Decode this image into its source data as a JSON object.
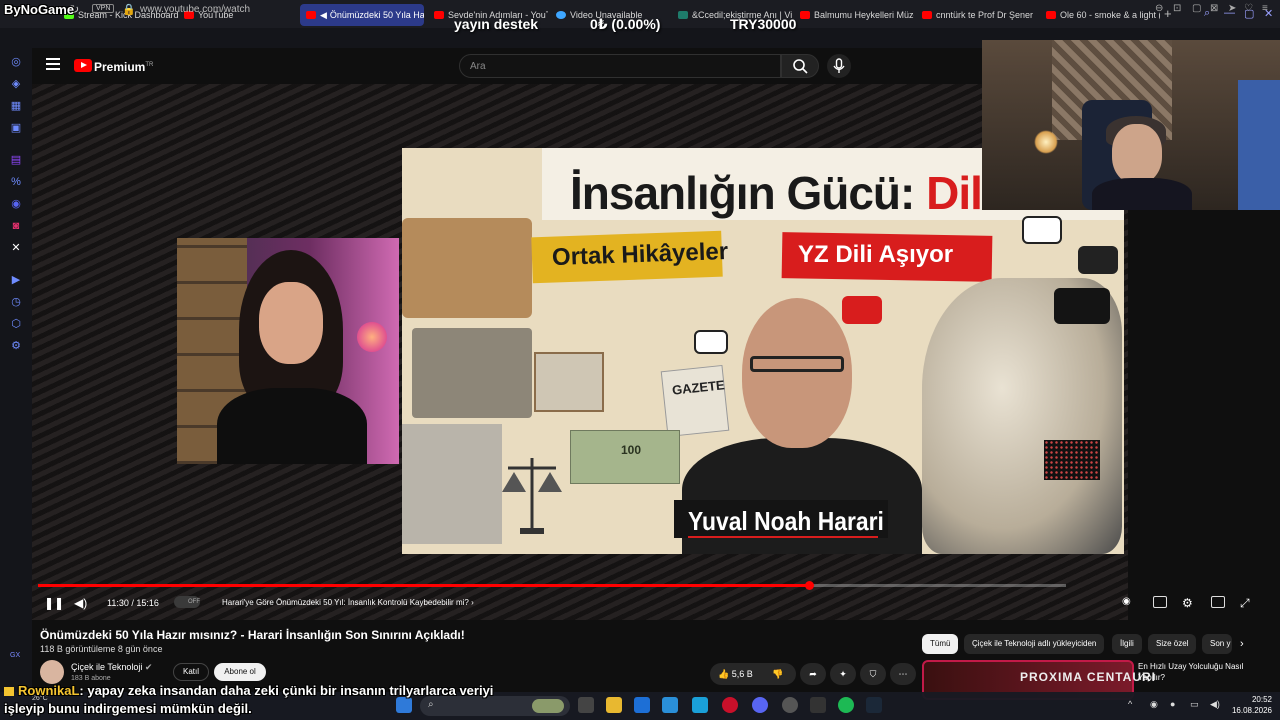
{
  "browser": {
    "brand": "ByNoGame",
    "tabs": [
      {
        "label": "Stream - Kick Dashboard",
        "favicon": "kick-icon"
      },
      {
        "label": "YouTube",
        "favicon": "youtube-icon"
      },
      {
        "label": "Önümüzdeki 50 Yıla Ha",
        "favicon": "youtube-icon",
        "active": true
      },
      {
        "label": "Sevde'nin Adımları - YouT",
        "favicon": "youtube-icon"
      },
      {
        "label": "Video Unavailable",
        "favicon": "info-icon"
      },
      {
        "label": "&Ccedil;ekiştirme Anı | Vi",
        "favicon": "vk-icon"
      },
      {
        "label": "Balmumu Heykelleri Müze",
        "favicon": "youtube-icon"
      },
      {
        "label": "cnntürk te Prof Dr Şener",
        "favicon": "youtube-icon"
      },
      {
        "label": "Ole 60 - smoke & a light (",
        "favicon": "youtube-icon"
      }
    ],
    "new_tab": "+",
    "vpn": "VPN",
    "url": "www.youtube.com/watch"
  },
  "stream_overlay": {
    "label": "yayın destek",
    "progress": "0₺ (0.00%)",
    "goal": "TRY30000"
  },
  "youtube": {
    "brand": "Premium",
    "region": "TR",
    "search_placeholder": "Ara"
  },
  "thumbnail": {
    "title_dark": "İnsanlığın Gücü:",
    "title_red": "Dil",
    "left_label": "Ortak Hikâyeler",
    "right_label": "YZ Dili Aşıyor",
    "newspaper": "GAZETE",
    "banknote": "100",
    "name": "Yuval Noah Harari"
  },
  "player": {
    "time": "11:30 / 15:16",
    "progress_fraction": 0.75,
    "autoplay_label": "OFF",
    "chapter": "Harari'ye Göre Önümüzdeki 50 Yıl: İnsanlık Kontrolü Kaybedebilir mi?"
  },
  "video": {
    "title": "Önümüzdeki 50 Yıla Hazır mısınız? - Harari İnsanlığın Son Sınırını Açıkladı!",
    "views": "118 B görüntüleme",
    "age": "8 gün önce",
    "channel": "Çiçek ile Teknoloji",
    "subscribers": "183 B abone",
    "join": "Katıl",
    "subscribe": "Abone ol",
    "likes": "5,6 B"
  },
  "chips": [
    "Tümü",
    "Çiçek ile Teknoloji adlı yükleyiciden",
    "İlgili",
    "Size özel",
    "Son y"
  ],
  "recommended": {
    "thumb_text": "PROXIMA CENTAURI",
    "title": "En Hızlı Uzay Yolculuğu Nasıl Yapılır?"
  },
  "chat": {
    "user": "RownikaL",
    "message_line1": ": yapay zeka insandan daha zeki çünki bir insanın trilyarlarca veriyi",
    "message_line2": "işleyip bunu indirgemesi mümkün değil."
  },
  "taskbar": {
    "weather": "26°C",
    "time": "20:52",
    "date": "16.08.2026",
    "sidebar_label": "GX"
  }
}
